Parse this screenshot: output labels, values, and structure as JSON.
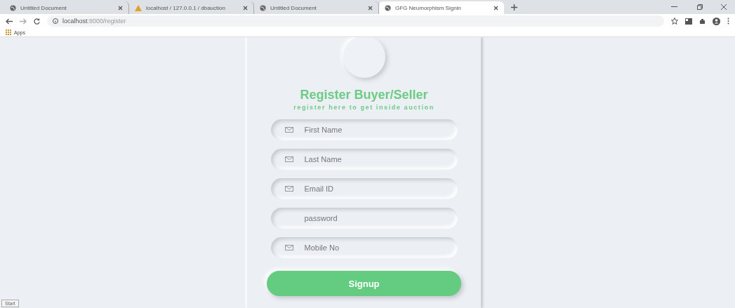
{
  "browser": {
    "tabs": [
      {
        "title": "Untitled Document",
        "kind": "globe",
        "selected": false
      },
      {
        "title": "localhost / 127.0.0.1 / dbauction",
        "kind": "warning",
        "selected": false
      },
      {
        "title": "Untitled Document",
        "kind": "globe",
        "selected": false
      },
      {
        "title": "GFG Neumorphism Signin",
        "kind": "globe",
        "selected": true
      }
    ],
    "address": {
      "host": "localhost",
      "path": ":8000/register"
    },
    "bookmarks": [
      "Apps"
    ]
  },
  "form": {
    "title": "Register Buyer/Seller",
    "subtitle": "register here to get inside auction",
    "fields": [
      {
        "placeholder": "First Name",
        "kind": "icon"
      },
      {
        "placeholder": "Last Name",
        "kind": "icon"
      },
      {
        "placeholder": "Email ID",
        "kind": "icon"
      },
      {
        "placeholder": "password",
        "kind": "plain"
      },
      {
        "placeholder": "Mobile No",
        "kind": "icon"
      }
    ],
    "button": "Signup"
  },
  "status_bar": "Start"
}
